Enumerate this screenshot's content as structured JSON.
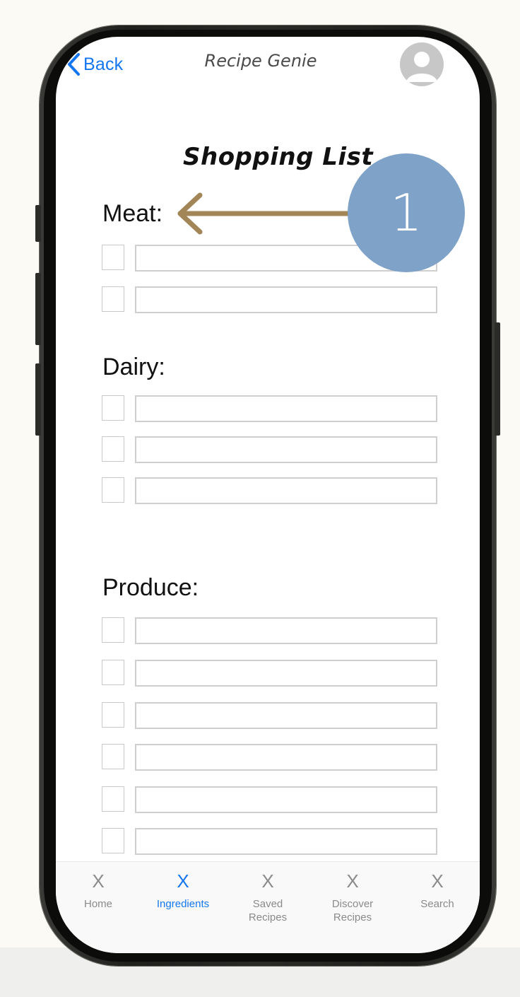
{
  "header": {
    "back_label": "Back",
    "app_title": "Recipe Genie",
    "avatar_icon": "user-avatar-icon"
  },
  "page": {
    "title": "Shopping List"
  },
  "sections": [
    {
      "title": "Meat:",
      "item_count": 2
    },
    {
      "title": "Dairy:",
      "item_count": 3
    },
    {
      "title": "Produce:",
      "item_count": 6
    }
  ],
  "annotation": {
    "badge_number": "1",
    "arrow_color": "#a38658",
    "badge_color": "#7fa2c8"
  },
  "tabbar": {
    "tabs": [
      {
        "icon": "X",
        "label": "Home",
        "active": false
      },
      {
        "icon": "X",
        "label": "Ingredients",
        "active": true
      },
      {
        "icon": "X",
        "label": "Saved\nRecipes",
        "active": false
      },
      {
        "icon": "X",
        "label": "Discover\nRecipes",
        "active": false
      },
      {
        "icon": "X",
        "label": "Search",
        "active": false
      }
    ]
  },
  "colors": {
    "accent": "#1577f0",
    "inactive": "#8a8a8a"
  }
}
